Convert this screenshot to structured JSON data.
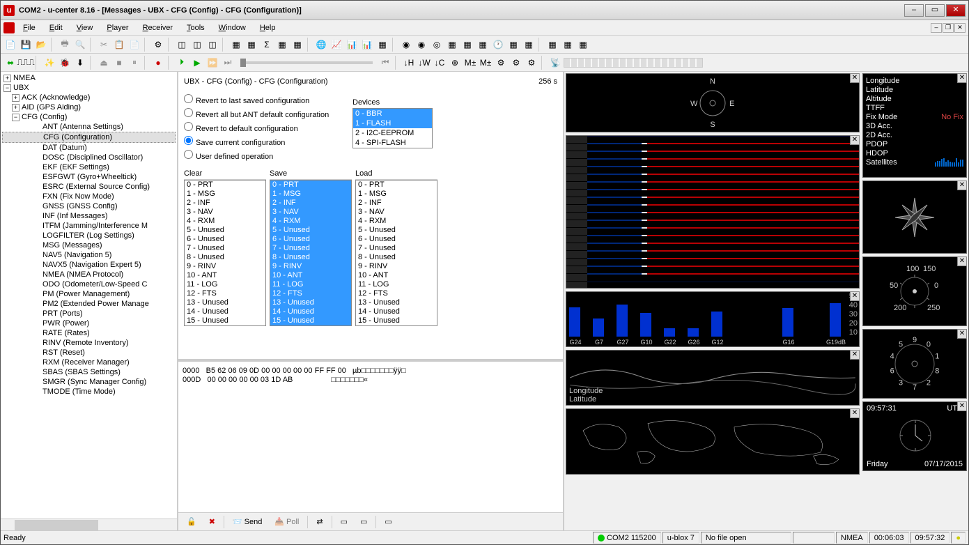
{
  "window": {
    "title": "COM2 - u-center 8.16 - [Messages - UBX - CFG (Config) - CFG (Configuration)]"
  },
  "menu": [
    "File",
    "Edit",
    "View",
    "Player",
    "Receiver",
    "Tools",
    "Window",
    "Help"
  ],
  "tree": {
    "root1": "NMEA",
    "root2": "UBX",
    "ack": "ACK (Acknowledge)",
    "aid": "AID (GPS Aiding)",
    "cfg": "CFG (Config)",
    "cfg_items": [
      "ANT (Antenna Settings)",
      "CFG (Configuration)",
      "DAT (Datum)",
      "DOSC (Disciplined Oscillator)",
      "EKF (EKF Settings)",
      "ESFGWT (Gyro+Wheeltick)",
      "ESRC (External Source Config)",
      "FXN (Fix Now Mode)",
      "GNSS (GNSS Config)",
      "INF (Inf Messages)",
      "ITFM (Jamming/Interference M",
      "LOGFILTER (Log Settings)",
      "MSG (Messages)",
      "NAV5 (Navigation 5)",
      "NAVX5 (Navigation Expert 5)",
      "NMEA (NMEA Protocol)",
      "ODO (Odometer/Low-Speed C",
      "PM (Power Management)",
      "PM2 (Extended Power Manage",
      "PRT (Ports)",
      "PWR (Power)",
      "RATE (Rates)",
      "RINV (Remote Inventory)",
      "RST (Reset)",
      "RXM (Receiver Manager)",
      "SBAS (SBAS Settings)",
      "SMGR (Sync Manager Config)",
      "TMODE (Time Mode)"
    ],
    "selected_index": 1
  },
  "cfg": {
    "breadcrumb": "UBX - CFG (Config) - CFG (Configuration)",
    "age": "256 s",
    "radios": [
      "Revert to last saved configuration",
      "Revert all but ANT default configuration",
      "Revert to default configuration",
      "Save current configuration",
      "User defined operation"
    ],
    "radio_selected": 3,
    "devices_label": "Devices",
    "devices": [
      "0 - BBR",
      "1 - FLASH",
      "2 - I2C-EEPROM",
      "4 - SPI-FLASH"
    ],
    "devices_selected": [
      0,
      1
    ],
    "col_labels": [
      "Clear",
      "Save",
      "Load"
    ],
    "list_items": [
      "0 - PRT",
      "1 - MSG",
      "2 - INF",
      "3 - NAV",
      "4 - RXM",
      "5 - Unused",
      "6 - Unused",
      "7 - Unused",
      "8 - Unused",
      "9 - RINV",
      "10 - ANT",
      "11 - LOG",
      "12 - FTS",
      "13 - Unused",
      "14 - Unused",
      "15 - Unused"
    ]
  },
  "hex": {
    "line1": "0000   B5 62 06 09 0D 00 00 00 00 00 FF FF 00   µb□□□□□□□ÿÿ□",
    "line2": "000D   00 00 00 00 00 03 1D AB                  □□□□□□□«"
  },
  "actions": {
    "send": "Send",
    "poll": "Poll"
  },
  "signal": {
    "sats": [
      "G24",
      "G7",
      "G27",
      "G10",
      "G22",
      "G26",
      "G12",
      "",
      "",
      "G16",
      "",
      "G19"
    ],
    "db_label": "dB",
    "heights": [
      35,
      22,
      38,
      28,
      10,
      10,
      30,
      0,
      0,
      34,
      0,
      40
    ],
    "scale": [
      "50",
      "40",
      "30",
      "20",
      "10"
    ]
  },
  "info": {
    "rows": [
      "Longitude",
      "Latitude",
      "Altitude",
      "TTFF",
      "Fix Mode",
      "3D Acc.",
      "2D Acc.",
      "PDOP",
      "HDOP",
      "Satellites"
    ],
    "fix_value": "No Fix"
  },
  "gauge1": {
    "ticks": [
      "100",
      "150",
      "50",
      "0",
      "200",
      "250"
    ]
  },
  "gauge2": {
    "ticks": [
      "9",
      "0",
      "1",
      "8",
      "2",
      "7",
      "3",
      "6",
      "4",
      "5"
    ]
  },
  "clock": {
    "time": "09:57:31",
    "zone": "UTC",
    "day": "Friday",
    "date": "07/17/2015"
  },
  "map": {
    "lon": "Longitude",
    "lat": "Latitude"
  },
  "status": {
    "ready": "Ready",
    "port": "COM2 115200",
    "device": "u-blox 7",
    "file": "No file open",
    "proto": "NMEA",
    "t1": "00:06:03",
    "t2": "09:57:32"
  }
}
